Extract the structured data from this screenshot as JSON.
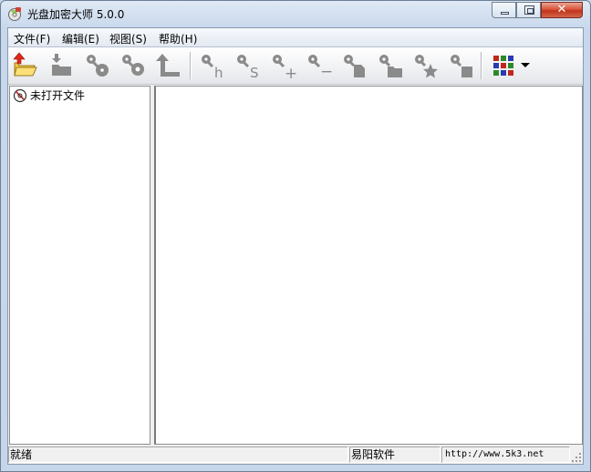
{
  "window": {
    "title": "光盘加密大师 5.0.0",
    "close_glyph": "✕",
    "app_icon": "disc-lock-icon"
  },
  "menu": {
    "items": [
      {
        "label": "文件(F)"
      },
      {
        "label": "编辑(E)"
      },
      {
        "label": "视图(S)"
      },
      {
        "label": "帮助(H)"
      }
    ]
  },
  "toolbar": {
    "buttons": [
      {
        "icon": "open-folder-icon"
      },
      {
        "icon": "import-folder-icon"
      },
      {
        "icon": "key-disc-icon"
      },
      {
        "icon": "key-disc-alt-icon"
      },
      {
        "icon": "up-arrow-icon"
      },
      {
        "icon": "key-hide-icon",
        "glyph": "h"
      },
      {
        "icon": "key-s-icon",
        "glyph": "S"
      },
      {
        "icon": "key-add-icon",
        "glyph": "+"
      },
      {
        "icon": "key-remove-icon",
        "glyph": "−"
      },
      {
        "icon": "key-file-icon"
      },
      {
        "icon": "key-folder-icon"
      },
      {
        "icon": "key-star-icon"
      },
      {
        "icon": "key-square-icon"
      },
      {
        "icon": "color-grid-icon"
      },
      {
        "icon": "dropdown-arrow-icon"
      }
    ]
  },
  "tree": {
    "items": [
      {
        "label": "未打开文件",
        "icon": "no-file-icon"
      }
    ]
  },
  "status": {
    "left": "就绪",
    "middle": "易阳软件",
    "right": "http://www.5k3.net"
  },
  "colors": {
    "accent_red": "#d9553c",
    "tool_gray": "#8a8a8a",
    "folder_yellow": "#f5c842"
  }
}
